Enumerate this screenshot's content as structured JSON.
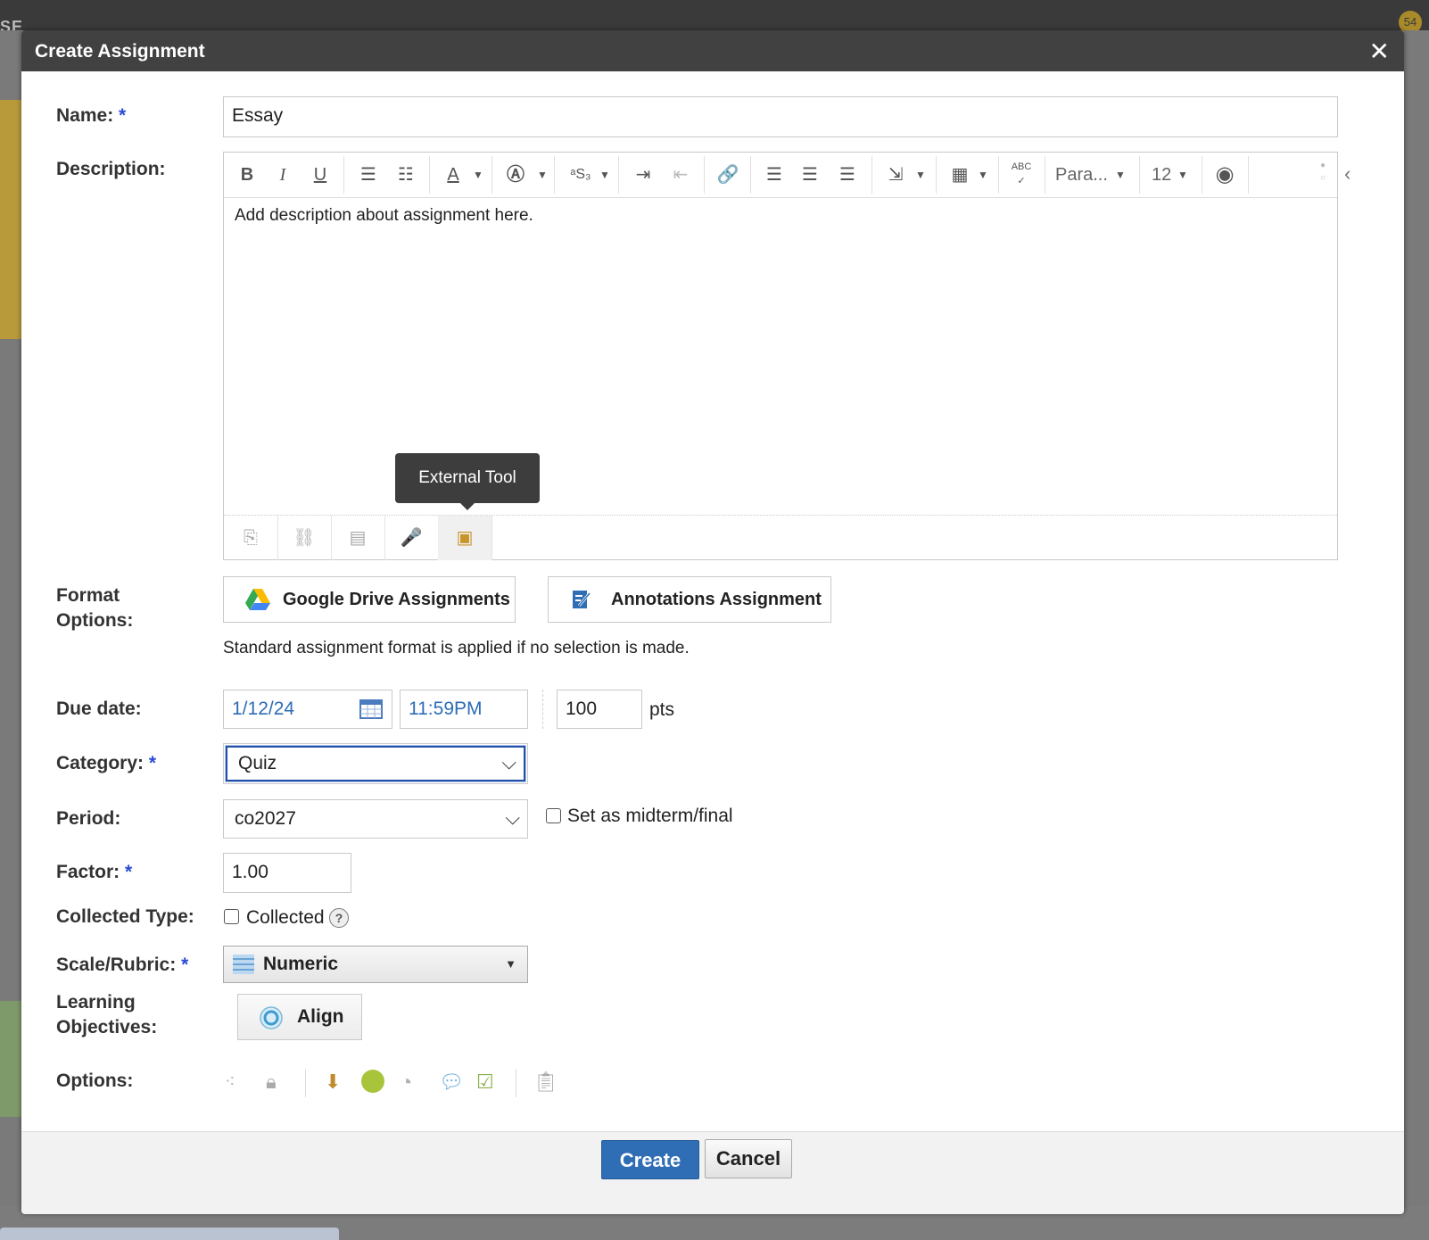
{
  "dialog": {
    "title": "Create Assignment",
    "close_glyph": "✕"
  },
  "background": {
    "nav_fragment": "SE",
    "badge_count": "54"
  },
  "name": {
    "label": "Name:",
    "required": "*",
    "value": "Essay"
  },
  "description": {
    "label": "Description:",
    "body_text": "Add description about assignment here.",
    "toolbar": {
      "paragraph_select": "Para...",
      "font_size": "12"
    },
    "tooltip": "External Tool"
  },
  "format_options": {
    "label_line1": "Format",
    "label_line2": "Options:",
    "google_button": "Google Drive Assignments",
    "annotations_button": "Annotations Assignment",
    "note": "Standard assignment format is applied if no selection is made."
  },
  "due_date": {
    "label": "Due date:",
    "date": "1/12/24",
    "time": "11:59PM",
    "points": "100",
    "points_unit": "pts"
  },
  "category": {
    "label": "Category:",
    "required": "*",
    "selected": "Quiz"
  },
  "period": {
    "label": "Period:",
    "selected": "co2027",
    "midterm_label": "Set as midterm/final"
  },
  "factor": {
    "label": "Factor:",
    "required": "*",
    "value": "1.00"
  },
  "collected_type": {
    "label": "Collected Type:",
    "checkbox_label": "Collected",
    "help_glyph": "?"
  },
  "scale_rubric": {
    "label": "Scale/Rubric:",
    "required": "*",
    "selected": "Numeric"
  },
  "learning_objectives": {
    "label_line1": "Learning",
    "label_line2": "Objectives:",
    "align_button": "Align"
  },
  "options": {
    "label": "Options:"
  },
  "footer": {
    "create_button": "Create",
    "cancel_button": "Cancel"
  },
  "colors": {
    "header": "#414141",
    "primary_button": "#2f6db5",
    "required_star": "#2a4bd1",
    "link_blue": "#2d6cb8"
  }
}
